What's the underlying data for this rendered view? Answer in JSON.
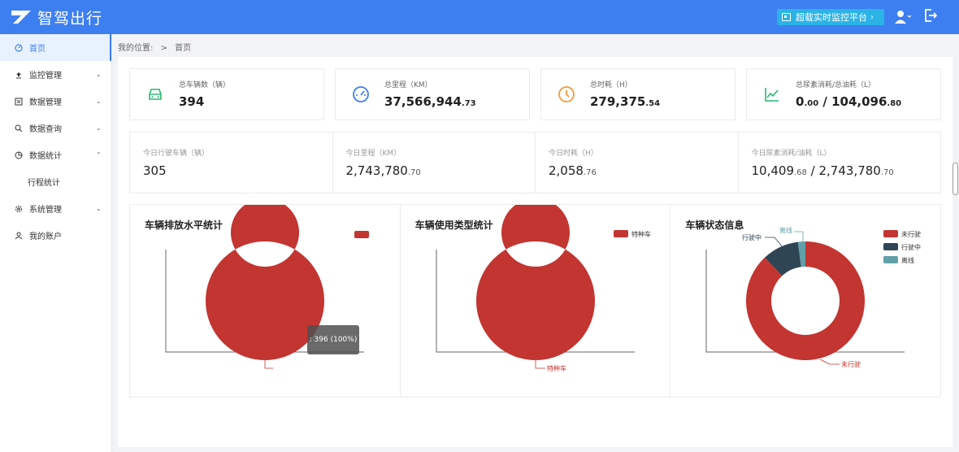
{
  "app": {
    "title": "智驾出行"
  },
  "header": {
    "monitor_label": "超载实时监控平台",
    "monitor_chevron": "›"
  },
  "sidebar": {
    "items": [
      {
        "label": "首页",
        "icon": "dashboard-icon",
        "active": true
      },
      {
        "label": "监控管理",
        "icon": "upload-icon",
        "arrow": "⌄"
      },
      {
        "label": "数据管理",
        "icon": "document-icon",
        "arrow": "⌄"
      },
      {
        "label": "数据查询",
        "icon": "search-icon",
        "arrow": "⌄"
      },
      {
        "label": "数据统计",
        "icon": "pie-icon",
        "arrow": "⌃"
      },
      {
        "label": "行程统计",
        "sub": true
      },
      {
        "label": "系统管理",
        "icon": "gear-icon",
        "arrow": "⌄"
      },
      {
        "label": "我的账户",
        "icon": "user-icon"
      }
    ]
  },
  "breadcrumb": {
    "prefix": "我的位置:",
    "sep": ">",
    "current": "首页"
  },
  "stats": [
    {
      "label": "总车辆数（辆）",
      "int": "394",
      "dec": "",
      "icon": "car-icon",
      "color": "#2bb673"
    },
    {
      "label": "总里程（KM）",
      "int": "37,566,944",
      "dec": ".73",
      "icon": "speedometer-icon",
      "color": "#3d7ff0"
    },
    {
      "label": "总时耗（H）",
      "int": "279,375",
      "dec": ".54",
      "icon": "clock-icon",
      "color": "#f39a3b"
    },
    {
      "label": "总尿素消耗/总油耗（L）",
      "int": "0",
      "dec": ".00",
      "extra_int": " / 104,096",
      "extra_dec": ".80",
      "icon": "line-chart-icon",
      "color": "#2bb673"
    }
  ],
  "today": [
    {
      "label": "今日行驶车辆（辆）",
      "int": "305",
      "dec": ""
    },
    {
      "label": "今日里程（KM）",
      "int": "2,743,780",
      "dec": ".70"
    },
    {
      "label": "今日时耗（H）",
      "int": "2,058",
      "dec": ".76"
    },
    {
      "label": "今日尿素消耗/油耗（L）",
      "int": "10,409",
      "dec": ".68",
      "extra_int": " / 2,743,780",
      "extra_dec": ".70"
    }
  ],
  "colors": {
    "primary": "#3d7ff0",
    "red": "#c23531",
    "dark": "#2f4554",
    "teal": "#61a0a8"
  },
  "chart_data": [
    {
      "type": "pie",
      "title": "车辆排放水平统计",
      "series": [
        {
          "values": [
            396
          ]
        }
      ],
      "categories": [
        ""
      ],
      "tooltip": ": 396 (100%)",
      "legend_placement": "top-right"
    },
    {
      "type": "pie",
      "title": "车辆使用类型统计",
      "categories": [
        "特种车"
      ],
      "values": [
        100
      ],
      "legend": [
        "特种车"
      ],
      "legend_placement": "top-right"
    },
    {
      "type": "pie",
      "title": "车辆状态信息",
      "categories": [
        "未行驶",
        "行驶中",
        "离线"
      ],
      "values": [
        88,
        10,
        2
      ],
      "legend": [
        "未行驶",
        "行驶中",
        "离线"
      ],
      "legend_placement": "top-right"
    }
  ]
}
